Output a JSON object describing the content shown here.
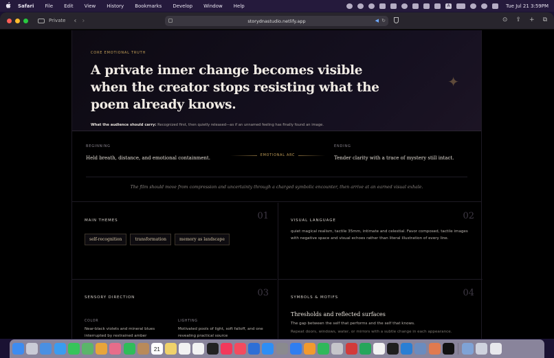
{
  "menubar": {
    "apple": "",
    "items": [
      "Safari",
      "File",
      "Edit",
      "View",
      "History",
      "Bookmarks",
      "Develop",
      "Window",
      "Help"
    ],
    "clock": "Tue Jul 21  3:59PM",
    "status_letter": "A"
  },
  "browser": {
    "private_label": "Private",
    "url": "storydnastudio.netlify.app",
    "back_glyph": "‹",
    "forward_glyph": "›"
  },
  "hero": {
    "eyebrow": "CORE EMOTIONAL TRUTH",
    "title": "A private inner change becomes visible when the creator stops resisting what the poem already knows.",
    "audience_label": "What the audience should carry:",
    "audience_text": " Recognized first, then quietly released—as if an unnamed feeling has finally found an image.",
    "sparkle": "✦"
  },
  "arc": {
    "beginning_label": "BEGINNING",
    "beginning_text": "Held breath, distance, and emotional containment.",
    "middle_label": "EMOTIONAL ARC",
    "ending_label": "ENDING",
    "ending_text": "Tender clarity with a trace of mystery still intact.",
    "quote": "The film should move from compression and uncertainty through a charged symbolic encounter, then arrive at an earned visual exhale."
  },
  "themes": {
    "title": "MAIN THEMES",
    "num": "01",
    "chips": [
      "self-recognition",
      "transformation",
      "memory as landscape"
    ]
  },
  "visual": {
    "title": "VISUAL LANGUAGE",
    "num": "02",
    "body": "quiet magical realism, tactile 35mm, intimate and celestial. Favor composed, tactile images with negative space and visual echoes rather than literal illustration of every line."
  },
  "sensory": {
    "title": "SENSORY DIRECTION",
    "num": "03",
    "color_label": "COLOR",
    "color_text": "Near-black violets and mineral blues interrupted by restrained amber",
    "lighting_label": "LIGHTING",
    "lighting_text": "Motivated pools of light, soft falloff, and one revealing practical source"
  },
  "motifs": {
    "title": "SYMBOLS & MOTIFS",
    "num": "04",
    "heading": "Thresholds and reflected surfaces",
    "line1": "The gap between the self that performs and the self that knows.",
    "line2": "Repeat doors, windows, water, or mirrors with a subtle change in each appearance."
  },
  "dock": {
    "calendar_day": "21",
    "apps": [
      {
        "name": "finder",
        "color": "#3d8cf0"
      },
      {
        "name": "launchpad",
        "color": "#c9cbd6"
      },
      {
        "name": "mail",
        "color": "#4a90e2"
      },
      {
        "name": "safari",
        "color": "#3a9cf0"
      },
      {
        "name": "messages",
        "color": "#36c45a"
      },
      {
        "name": "maps",
        "color": "#5bb56a"
      },
      {
        "name": "chrome",
        "color": "#e8a53a"
      },
      {
        "name": "photos",
        "color": "#e76d8a"
      },
      {
        "name": "facetime",
        "color": "#2ebd59"
      },
      {
        "name": "contacts",
        "color": "#b98a5a"
      },
      {
        "name": "calendar",
        "color": "#ffffff"
      },
      {
        "name": "notes",
        "color": "#f0d26a"
      },
      {
        "name": "reminders",
        "color": "#f2f2f2"
      },
      {
        "name": "freeform",
        "color": "#f2f2f2"
      },
      {
        "name": "tv",
        "color": "#222222"
      },
      {
        "name": "music",
        "color": "#f2395b"
      },
      {
        "name": "news",
        "color": "#f44b5e"
      },
      {
        "name": "keynote",
        "color": "#2d6fd6"
      },
      {
        "name": "app-store",
        "color": "#2e8ef5"
      },
      {
        "name": "system-settings",
        "color": "#8a8a8e"
      },
      {
        "name": "xcode",
        "color": "#2f7ef0"
      },
      {
        "name": "pages",
        "color": "#f29a2e"
      },
      {
        "name": "numbers",
        "color": "#2fb85a"
      },
      {
        "name": "h-app",
        "color": "#c5c5ca"
      },
      {
        "name": "rp-app",
        "color": "#d33a3a"
      },
      {
        "name": "vpn",
        "color": "#26a65b"
      },
      {
        "name": "chatgpt",
        "color": "#f2f2f2"
      },
      {
        "name": "terminal",
        "color": "#1e1e1e"
      },
      {
        "name": "vscode",
        "color": "#2a7fd4"
      },
      {
        "name": "preview",
        "color": "#6a8cbf"
      },
      {
        "name": "claude",
        "color": "#e07a4f"
      },
      {
        "name": "cursor",
        "color": "#111111"
      }
    ],
    "trailing": [
      {
        "name": "downloads",
        "color": "#7fa3d6"
      },
      {
        "name": "screenshot",
        "color": "#cfd3de"
      },
      {
        "name": "trash",
        "color": "#e8e8ec"
      }
    ]
  }
}
